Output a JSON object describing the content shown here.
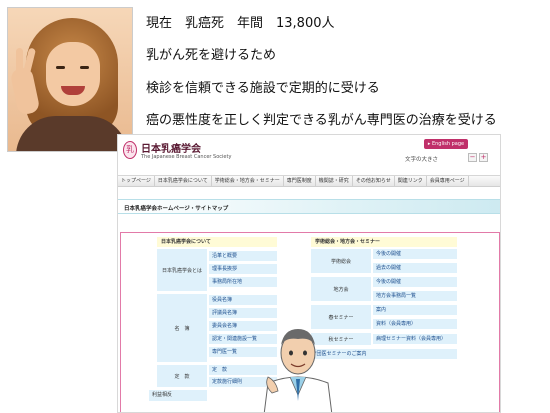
{
  "slide": {
    "lines": [
      "現在　乳癌死　年間　13,800人",
      "乳がん死を避けるため",
      "検診を信頼できる施設で定期的に受ける",
      "癌の悪性度を正しく判定できる乳がん専門医の治療を受ける"
    ]
  },
  "site": {
    "logo_mark": "乳",
    "title": "日本乳癌学会",
    "subtitle": "The Japanese Breast Cancer Society",
    "english_button": "▸ English page",
    "font_size_label": "文字の大きさ",
    "font_minus": "−",
    "font_plus": "+",
    "nav": [
      "トップページ",
      "日本乳癌学会について",
      "学術総会・地方会・セミナー",
      "専門医制度",
      "機関誌・研究",
      "その他お知らせ",
      "関連リンク",
      "会員専用ページ"
    ],
    "page_heading": "日本乳癌学会ホームページ・サイトマップ",
    "sitemap": {
      "left_header": "日本乳癌学会について",
      "right_header": "学術総会・地方会・セミナー",
      "left_groups": [
        {
          "label": "日本乳癌学会とは",
          "links": [
            "沿革と概要",
            "理事長挨拶",
            "事務局所在地"
          ]
        },
        {
          "label": "名　簿",
          "links": [
            "役員名簿",
            "評議員名簿",
            "委員会名簿",
            "認定・関連施設一覧",
            "専門医一覧"
          ]
        },
        {
          "label": "定　款",
          "links": [
            "定　款",
            "定款施行細則"
          ]
        },
        {
          "label": "利益相反",
          "links": []
        }
      ],
      "right_groups": [
        {
          "label": "学術総会",
          "links": [
            "今後の開催",
            "過去の開催"
          ]
        },
        {
          "label": "地方会",
          "links": [
            "今後の開催",
            "地方会事務局一覧"
          ]
        },
        {
          "label": "春セミナー",
          "links": [
            "案内",
            "資料（会員専用）"
          ]
        },
        {
          "label": "秋セミナー",
          "links": [
            "病理セミナー資料（会員専用）"
          ]
        },
        {
          "label": "",
          "links": [
            "*団医セミナーのご案内"
          ]
        }
      ]
    }
  }
}
